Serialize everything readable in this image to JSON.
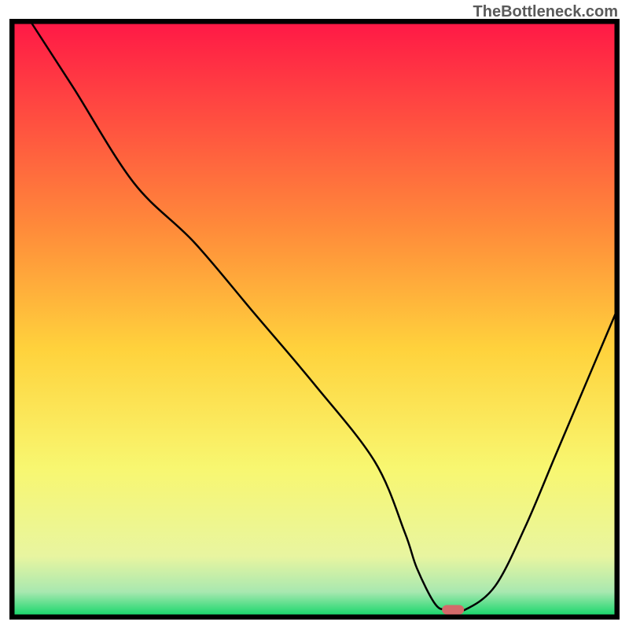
{
  "watermark": "TheBottleneck.com",
  "chart_data": {
    "type": "line",
    "title": "",
    "xlabel": "",
    "ylabel": "",
    "xlim": [
      0,
      100
    ],
    "ylim": [
      0,
      100
    ],
    "series": [
      {
        "name": "curve",
        "x": [
          3,
          10,
          20,
          30,
          40,
          50,
          60,
          65,
          67,
          70,
          72,
          75,
          80,
          85,
          90,
          95,
          100
        ],
        "values": [
          100,
          89,
          73,
          63,
          51,
          39,
          26,
          14,
          8,
          2,
          1,
          1,
          5,
          15,
          27,
          39,
          51
        ]
      }
    ],
    "marker": {
      "x": 73,
      "y": 1,
      "color": "#d46a6a"
    },
    "gradient_stops": [
      {
        "offset": 0,
        "color": "#ff1946"
      },
      {
        "offset": 35,
        "color": "#ff8c3a"
      },
      {
        "offset": 55,
        "color": "#ffd23c"
      },
      {
        "offset": 75,
        "color": "#f8f770"
      },
      {
        "offset": 90,
        "color": "#e8f5a0"
      },
      {
        "offset": 96,
        "color": "#a8e8b0"
      },
      {
        "offset": 100,
        "color": "#16d66a"
      }
    ],
    "frame_color": "#000000"
  }
}
